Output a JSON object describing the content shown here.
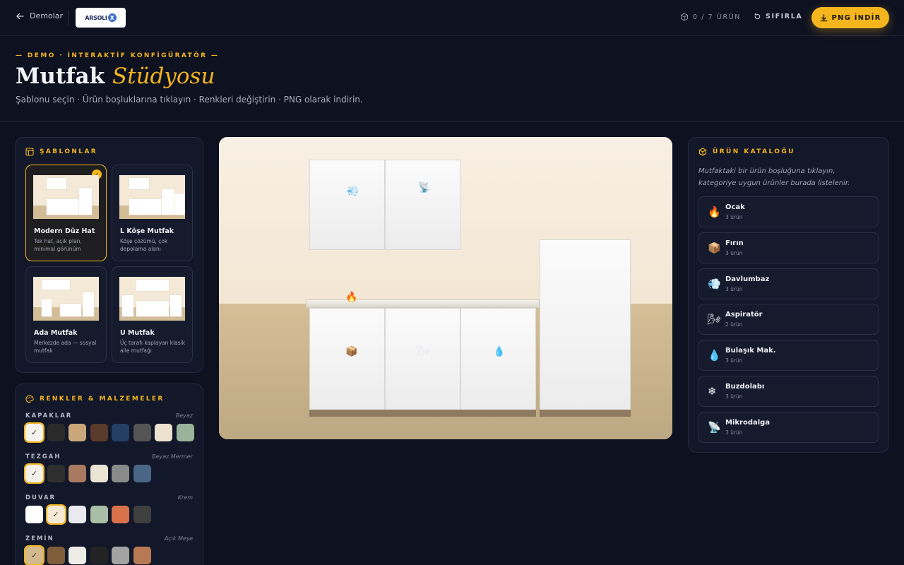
{
  "header": {
    "back_label": "Demolar",
    "logo_text": "ARSOLI",
    "logo_mark": "X",
    "counter": "0 / 7 ÜRÜN",
    "reset_label": "SIFIRLA",
    "png_label": "PNG İNDİR"
  },
  "hero": {
    "eyebrow": "— DEMO · İNTERAKTİF KONFİGÜRATÖR —",
    "title_main": "Mutfak",
    "title_accent": "Stüdyosu",
    "subtitle": "Şablonu seçin · Ürün boşluklarına tıklayın · Renkleri değiştirin · PNG olarak indirin."
  },
  "templates": {
    "title": "ŞABLONLAR",
    "items": [
      {
        "name": "Modern Düz Hat",
        "desc": "Tek hat, açık plan, minimal görünüm",
        "active": true
      },
      {
        "name": "L Köşe Mutfak",
        "desc": "Köşe çözümü, çok depolama alanı",
        "active": false
      },
      {
        "name": "Ada Mutfak",
        "desc": "Merkezde ada — sosyal mutfak",
        "active": false
      },
      {
        "name": "U Mutfak",
        "desc": "Üç tarafı kaplayan klasik aile mutfağı",
        "active": false
      }
    ]
  },
  "colors": {
    "title": "RENKLER & MALZEMELER",
    "groups": [
      {
        "label": "KAPAKLAR",
        "value": "Beyaz",
        "swatches": [
          "#f5f3ee",
          "#2a2a2a",
          "#c9a77a",
          "#5a3a2a",
          "#253e63",
          "#545454",
          "#ece2cf",
          "#98b39a"
        ],
        "selected": 0
      },
      {
        "label": "TEZGAH",
        "value": "Beyaz Mermer",
        "swatches": [
          "#f4f1ea",
          "#2f2f2f",
          "#a87a60",
          "#ebe3d4",
          "#8a8a8a",
          "#4a6685"
        ],
        "selected": 0
      },
      {
        "label": "DUVAR",
        "value": "Krem",
        "swatches": [
          "#ffffff",
          "#f4e9d3",
          "#e8eaf0",
          "#a9bea6",
          "#d9714a",
          "#3f3f3f"
        ],
        "selected": 1
      },
      {
        "label": "ZEMİN",
        "value": "Açık Meşe",
        "swatches": [
          "#d2b98e",
          "#7f5d3b",
          "#eeece7",
          "#232323",
          "#a3a3a3",
          "#b77954"
        ],
        "selected": 0
      }
    ]
  },
  "stage": {
    "slots": [
      {
        "icon": "💨",
        "name": "davlumbaz-slot"
      },
      {
        "icon": "📡",
        "name": "mikrodalga-slot"
      },
      {
        "icon": "🔥",
        "name": "ocak-slot"
      },
      {
        "icon": "📦",
        "name": "firin-slot"
      },
      {
        "icon": "🌬",
        "name": "aspirator-slot"
      },
      {
        "icon": "💧",
        "name": "bulasik-slot"
      }
    ]
  },
  "catalog": {
    "title": "ÜRÜN KATALOĞU",
    "hint": "Mutfaktaki bir ürün boşluğuna tıklayın, kategoriye uygun ürünler burada listelenir.",
    "items": [
      {
        "icon": "🔥",
        "name": "Ocak",
        "count": "3 ürün"
      },
      {
        "icon": "📦",
        "name": "Fırın",
        "count": "3 ürün"
      },
      {
        "icon": "💨",
        "name": "Davlumbaz",
        "count": "3 ürün"
      },
      {
        "icon": "🌬",
        "name": "Aspiratör",
        "count": "2 ürün"
      },
      {
        "icon": "💧",
        "name": "Bulaşık Mak.",
        "count": "3 ürün"
      },
      {
        "icon": "❄",
        "name": "Buzdolabı",
        "count": "3 ürün"
      },
      {
        "icon": "📡",
        "name": "Mikrodalga",
        "count": "3 ürün"
      }
    ]
  }
}
